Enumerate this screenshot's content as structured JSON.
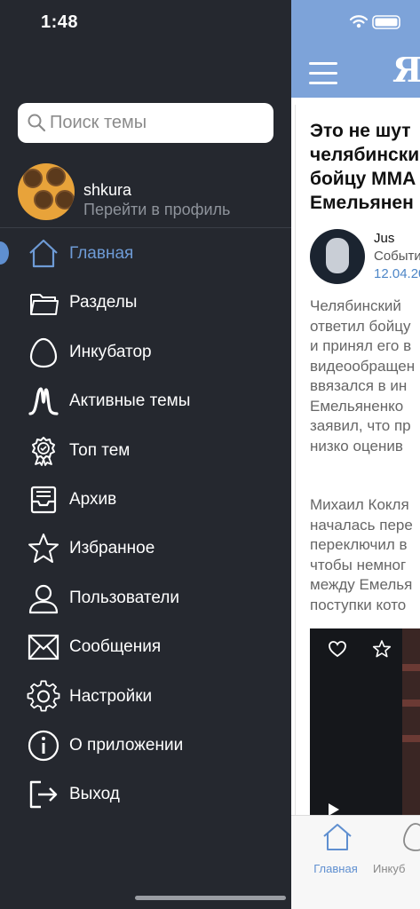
{
  "status_bar": {
    "time": "1:48"
  },
  "sidebar": {
    "search": {
      "placeholder": "Поиск темы",
      "value": ""
    },
    "profile": {
      "username": "shkura",
      "link_label": "Перейти в профиль"
    },
    "items": [
      {
        "label": "Главная",
        "icon": "home-icon",
        "active": true
      },
      {
        "label": "Разделы",
        "icon": "folder-icon"
      },
      {
        "label": "Инкубатор",
        "icon": "egg-icon"
      },
      {
        "label": "Активные темы",
        "icon": "activity-icon"
      },
      {
        "label": "Топ тем",
        "icon": "award-badge-icon"
      },
      {
        "label": "Архив",
        "icon": "archive-icon"
      },
      {
        "label": "Избранное",
        "icon": "star-icon"
      },
      {
        "label": "Пользователи",
        "icon": "user-icon"
      },
      {
        "label": "Сообщения",
        "icon": "mail-icon"
      },
      {
        "label": "Настройки",
        "icon": "gear-icon"
      },
      {
        "label": "О приложении",
        "icon": "info-icon"
      },
      {
        "label": "Выход",
        "icon": "logout-icon"
      }
    ]
  },
  "main": {
    "logo_text": "Яп",
    "article": {
      "title": "Это не шут\nчелябински\nбойцу ММА\nЕмельянен",
      "author": {
        "name": "Jus",
        "category": "Событи",
        "date": "12.04.20"
      },
      "paragraph_1": "Челябинский \nответил бойцу\nи принял его в\nвидеообращен\nввязался в ин\nЕмельяненко \nзаявил, что пр\nнизко оценив",
      "paragraph_2": "Михаил Кокля\nначалась пере\nпереключил в\nчтобы немног\nмежду Емелья\nпоступки кото"
    },
    "tabbar": [
      {
        "label": "Главная",
        "icon": "home-icon",
        "active": true
      },
      {
        "label": "Инкуб",
        "icon": "egg-icon"
      }
    ]
  },
  "colors": {
    "sidebar_bg": "#25282f",
    "accent": "#6e9bd6",
    "topbar": "#7da3d9",
    "date_link": "#4d86c7"
  }
}
